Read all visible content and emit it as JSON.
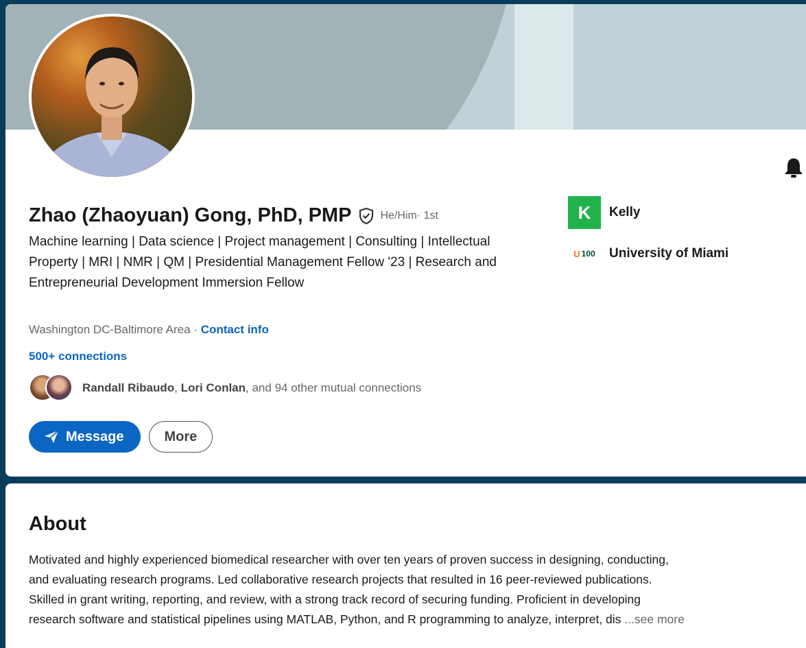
{
  "profile": {
    "name": "Zhao (Zhaoyuan) Gong, PhD, PMP",
    "pronouns": "He/Him",
    "degree": " · 1st",
    "headline": "Machine learning | Data science | Project management | Consulting | Intellectual Property | MRI | NMR | QM | Presidential Management Fellow '23 | Research and Entrepreneurial Development Immersion Fellow",
    "location": "Washington DC-Baltimore Area · ",
    "contact_info": "Contact info",
    "connections": "500+ connections",
    "mutual": {
      "name1": "Randall Ribaudo",
      "sep": ", ",
      "name2": "Lori Conlan",
      "rest": ", and 94 other mutual connections"
    }
  },
  "actions": {
    "message_label": "Message",
    "more_label": "More"
  },
  "orgs": [
    {
      "logo_text": "K",
      "name": "Kelly"
    },
    {
      "logo_text": "100",
      "name": "University of Miami"
    }
  ],
  "about": {
    "title": "About",
    "lines": [
      "Motivated and highly experienced biomedical researcher with over ten years of proven success in designing, conducting,",
      "and evaluating research programs. Led collaborative research projects that resulted in 16 peer-reviewed publications.",
      "Skilled in grant writing, reporting, and review, with a strong track record of securing funding. Proficient in developing",
      "research software and statistical pipelines using MATLAB, Python, and R programming to analyze, interpret, dis "
    ],
    "see_more": "...see more"
  },
  "colors": {
    "accent": "#0a66c2",
    "background": "#0a3d5c",
    "kelly_green": "#22b24c"
  },
  "icons": [
    "verified-shield-icon",
    "bell-icon",
    "send-icon"
  ]
}
